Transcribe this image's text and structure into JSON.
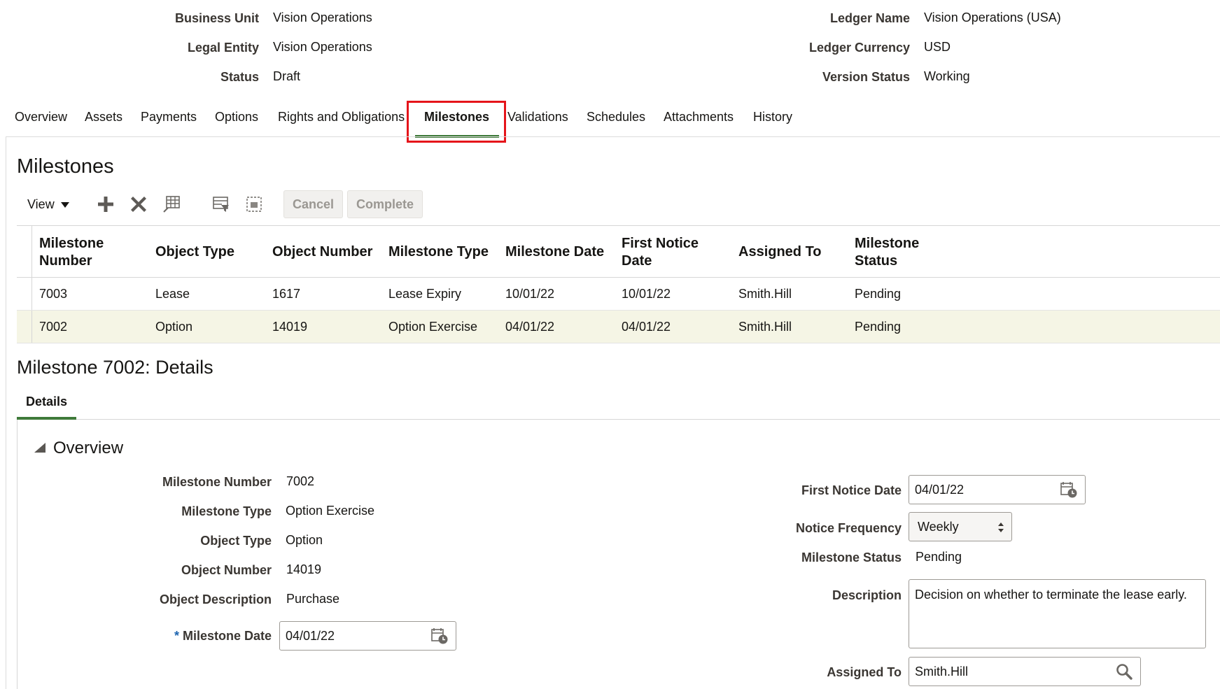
{
  "header": {
    "business_unit_label": "Business Unit",
    "business_unit": "Vision Operations",
    "legal_entity_label": "Legal Entity",
    "legal_entity": "Vision Operations",
    "status_label": "Status",
    "status": "Draft",
    "ledger_name_label": "Ledger Name",
    "ledger_name": "Vision Operations (USA)",
    "ledger_currency_label": "Ledger Currency",
    "ledger_currency": "USD",
    "version_status_label": "Version Status",
    "version_status": "Working"
  },
  "tabs": [
    "Overview",
    "Assets",
    "Payments",
    "Options",
    "Rights and Obligations",
    "Milestones",
    "Validations",
    "Schedules",
    "Attachments",
    "History"
  ],
  "active_tab": "Milestones",
  "section_title": "Milestones",
  "toolbar": {
    "view_label": "View",
    "cancel_label": "Cancel",
    "complete_label": "Complete"
  },
  "table": {
    "headers": [
      "Milestone Number",
      "Object Type",
      "Object Number",
      "Milestone Type",
      "Milestone Date",
      "First Notice Date",
      "Assigned To",
      "Milestone Status"
    ],
    "rows": [
      [
        "7003",
        "Lease",
        "1617",
        "Lease Expiry",
        "10/01/22",
        "10/01/22",
        "Smith.Hill",
        "Pending"
      ],
      [
        "7002",
        "Option",
        "14019",
        "Option Exercise",
        "04/01/22",
        "04/01/22",
        "Smith.Hill",
        "Pending"
      ]
    ],
    "selected_row": 1
  },
  "details": {
    "title": "Milestone 7002: Details",
    "subtab": "Details",
    "overview_title": "Overview",
    "milestone_number_label": "Milestone Number",
    "milestone_number": "7002",
    "milestone_type_label": "Milestone Type",
    "milestone_type": "Option Exercise",
    "object_type_label": "Object Type",
    "object_type": "Option",
    "object_number_label": "Object Number",
    "object_number": "14019",
    "object_description_label": "Object Description",
    "object_description": "Purchase",
    "milestone_date_required": "*",
    "milestone_date_label": "Milestone Date",
    "milestone_date": "04/01/22",
    "first_notice_date_label": "First Notice Date",
    "first_notice_date": "04/01/22",
    "notice_frequency_label": "Notice Frequency",
    "notice_frequency": "Weekly",
    "milestone_status_label": "Milestone Status",
    "milestone_status": "Pending",
    "description_label": "Description",
    "description": "Decision on whether to terminate the lease early.",
    "assigned_to_label": "Assigned To",
    "assigned_to": "Smith.Hill"
  },
  "colors": {
    "accent_green": "#3f7a3a",
    "highlight_red": "#e5141a",
    "selected_row": "#f5f5e5",
    "required_star": "#1e65b0"
  },
  "icons": [
    "add-icon",
    "delete-icon",
    "freeze-icon",
    "query-by-example-icon",
    "detach-icon",
    "calendar-icon",
    "search-icon",
    "dropdown-arrow-icon",
    "collapse-triangle-icon"
  ]
}
